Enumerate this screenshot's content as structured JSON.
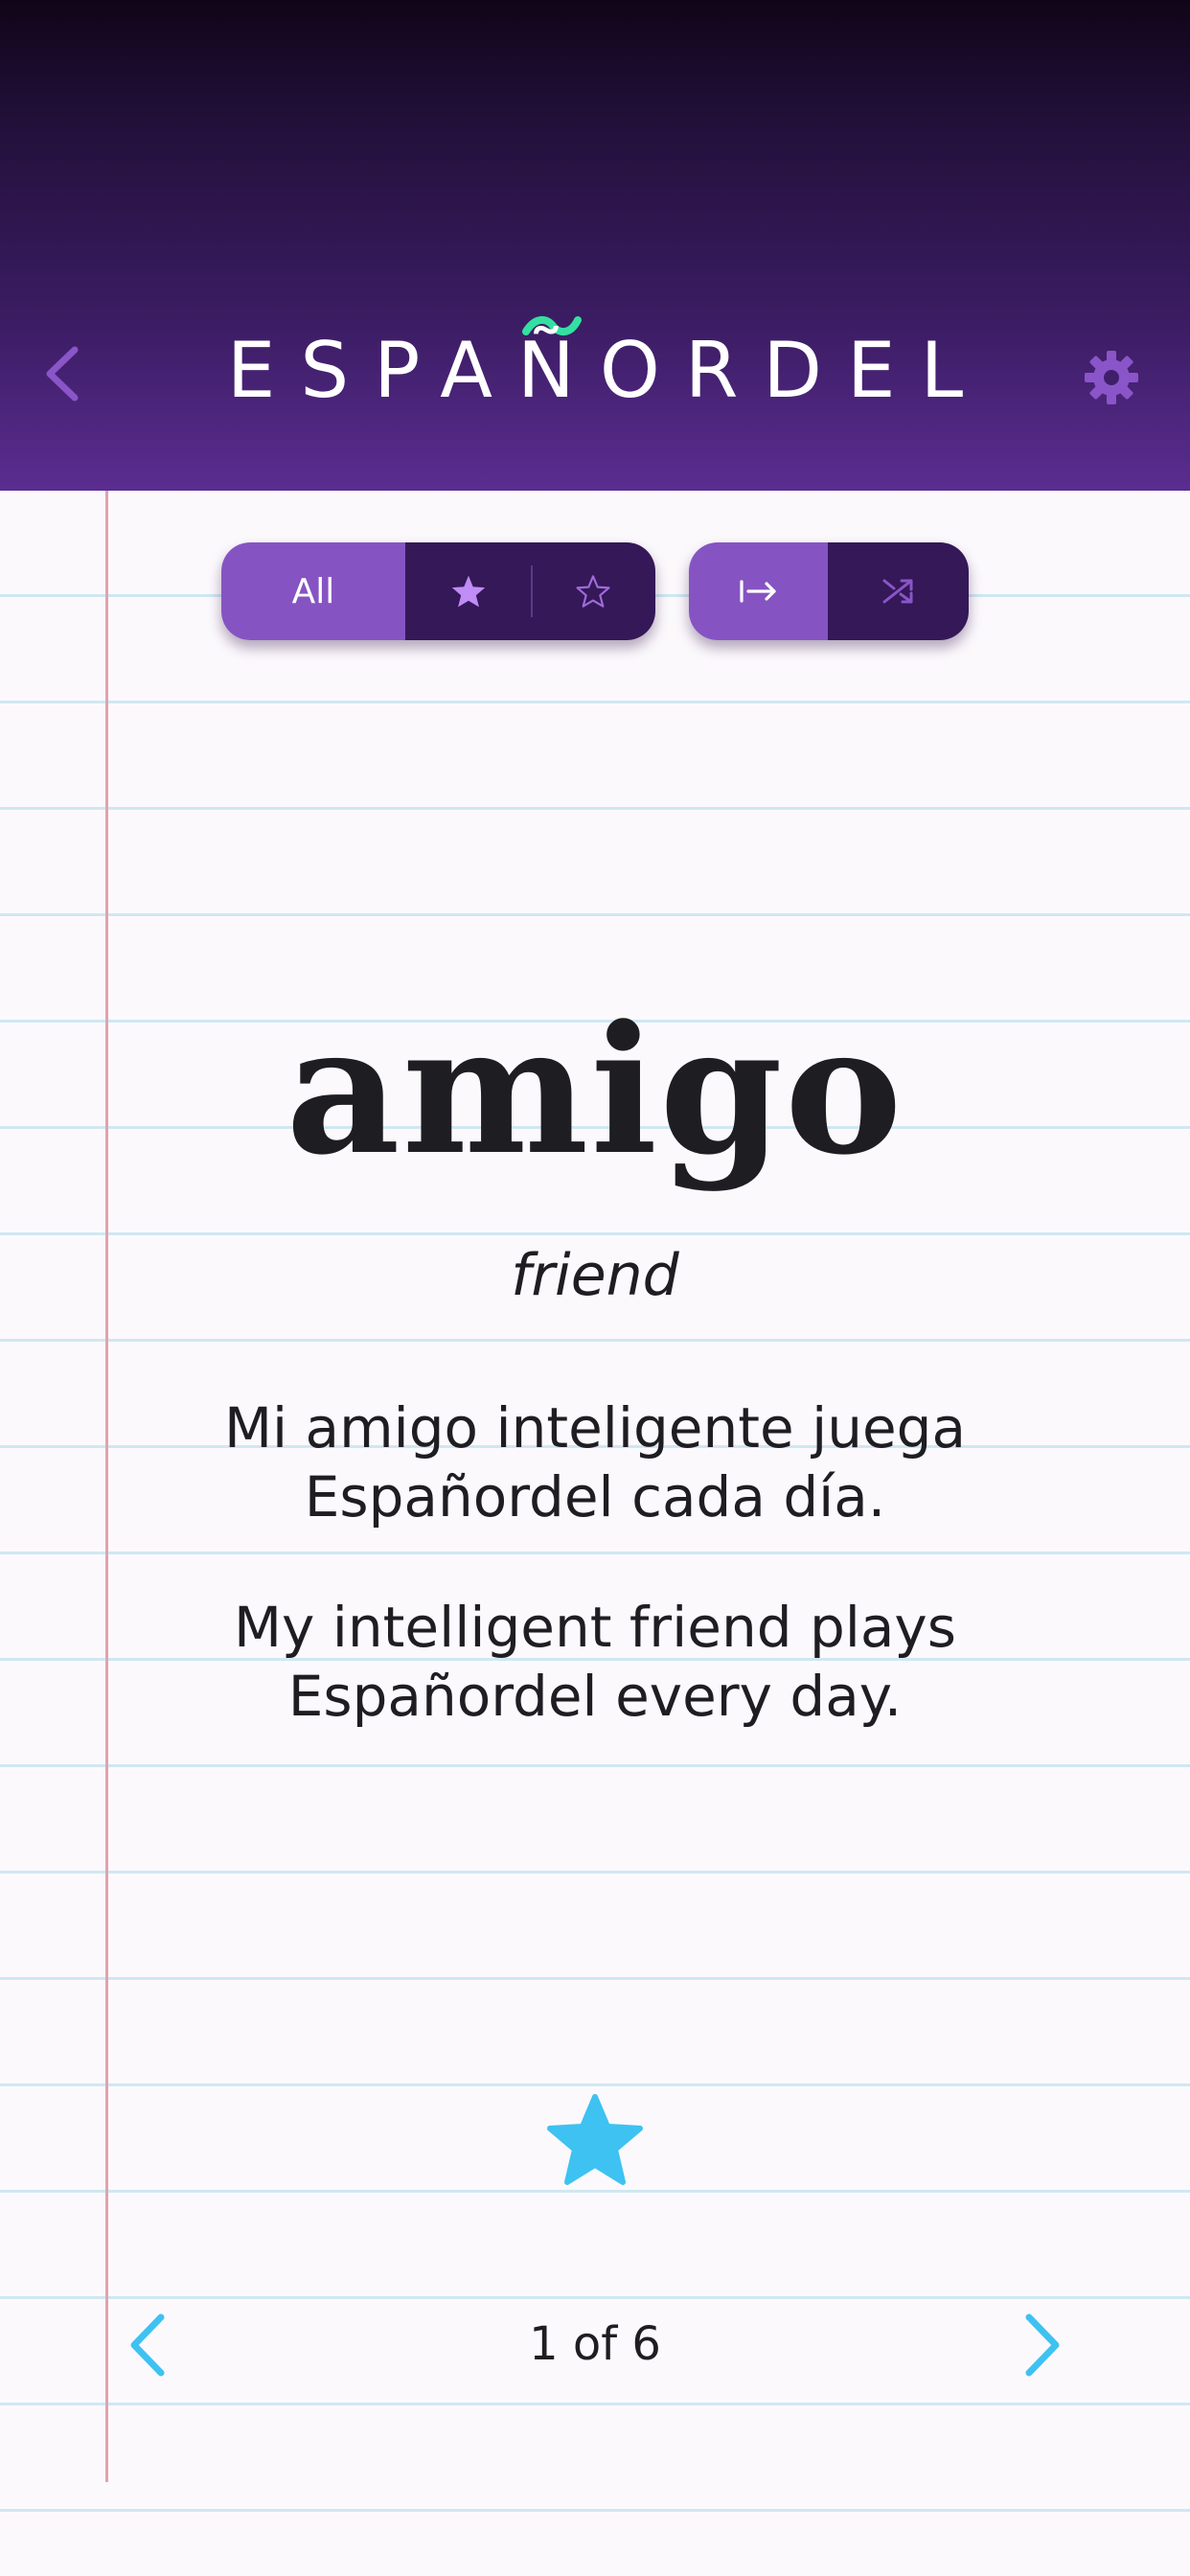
{
  "header": {
    "logo_text": "ESPAÑORDEL",
    "back_icon": "chevron-left-icon",
    "settings_icon": "gear-icon",
    "accent_color": "#34e0a1"
  },
  "filters": {
    "all_label": "All",
    "starred_icon": "star-filled-icon",
    "unstarred_icon": "star-outline-icon",
    "selected": "All"
  },
  "order": {
    "sequential_icon": "arrow-right-from-bar-icon",
    "shuffle_icon": "shuffle-icon",
    "selected": "sequential"
  },
  "card": {
    "word": "amigo",
    "translation": "friend",
    "example_es": "Mi amigo inteligente juega Españordel cada día.",
    "example_en": "My intelligent friend plays Españordel every day.",
    "starred": true,
    "star_color": "#3ec2f2"
  },
  "pager": {
    "counter": "1 of 6",
    "prev_icon": "chevron-left-icon",
    "next_icon": "chevron-right-icon",
    "nav_color": "#3ec2f2"
  }
}
